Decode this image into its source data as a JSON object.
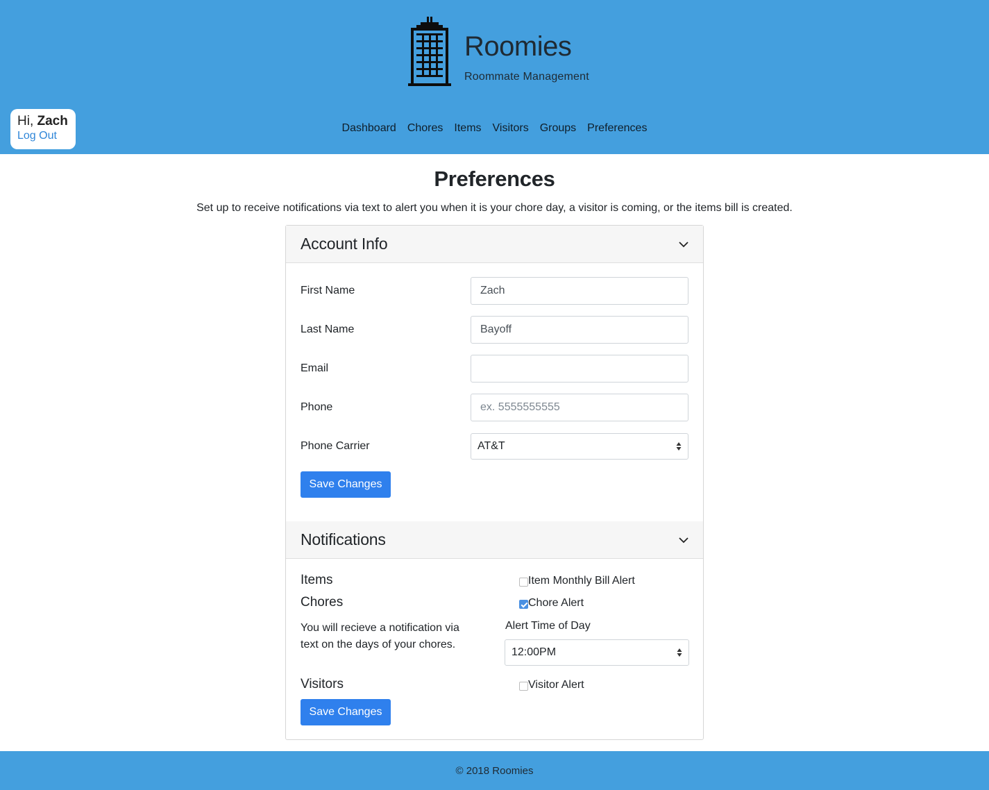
{
  "brand": {
    "title": "Roomies",
    "subtitle": "Roommate Management",
    "logo_icon": "building-icon"
  },
  "user": {
    "greeting_prefix": "Hi, ",
    "name": "Zach",
    "logout_label": "Log Out"
  },
  "nav": {
    "items": [
      "Dashboard",
      "Chores",
      "Items",
      "Visitors",
      "Groups",
      "Preferences"
    ]
  },
  "page": {
    "title": "Preferences",
    "description": "Set up to receive notifications via text to alert you when it is your chore day, a visitor is coming, or the items bill is created."
  },
  "account": {
    "heading": "Account Info",
    "fields": {
      "first_name": {
        "label": "First Name",
        "value": "Zach"
      },
      "last_name": {
        "label": "Last Name",
        "value": "Bayoff"
      },
      "email": {
        "label": "Email",
        "value": ""
      },
      "phone": {
        "label": "Phone",
        "value": "",
        "placeholder": "ex. 5555555555"
      },
      "carrier": {
        "label": "Phone Carrier",
        "value": "AT&T"
      }
    },
    "save_label": "Save Changes"
  },
  "notifications": {
    "heading": "Notifications",
    "items": {
      "label": "Items",
      "check_label": "Item Monthly Bill Alert",
      "checked": false
    },
    "chores": {
      "label": "Chores",
      "check_label": "Chore Alert",
      "checked": true,
      "description": "You will recieve a notification via text on the days of your chores.",
      "time_label": "Alert Time of Day",
      "time_value": "12:00PM"
    },
    "visitors": {
      "label": "Visitors",
      "check_label": "Visitor Alert",
      "checked": false
    },
    "save_label": "Save Changes"
  },
  "footer": {
    "text": "© 2018 Roomies"
  },
  "colors": {
    "header_bg": "#449fde",
    "primary_button": "#2f80ed",
    "link": "#2f86d8"
  }
}
